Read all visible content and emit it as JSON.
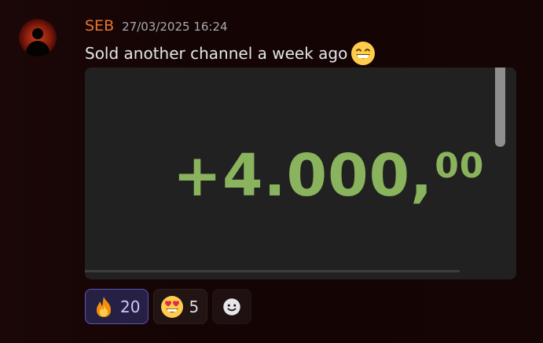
{
  "message": {
    "author": "SEB",
    "timestamp": "27/03/2025 16:24",
    "text": "Sold another channel a week ago",
    "inline_emoji": "grinning-face-with-smiling-eyes"
  },
  "attachment": {
    "amount_main": "+4.000,",
    "amount_cents": "00",
    "amount_color": "#8ab35e"
  },
  "reactions": [
    {
      "emoji": "fire",
      "count": "20",
      "active": true
    },
    {
      "emoji": "heart-eyes",
      "count": "5",
      "active": false
    },
    {
      "emoji": "add-reaction",
      "count": "",
      "active": false
    }
  ],
  "colors": {
    "username": "#e8742f",
    "active_reaction_border": "#5a53b8"
  }
}
